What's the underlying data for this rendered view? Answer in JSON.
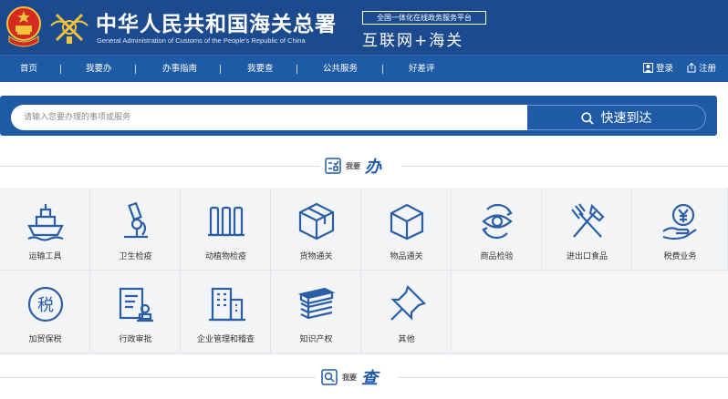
{
  "header": {
    "title": "中华人民共和国海关总署",
    "subtitle": "General Administration of Customs of the People's Republic of China",
    "platform_tag": "全国一体化在线政务服务平台",
    "platform_name": "互联网+海关"
  },
  "nav": {
    "items": [
      {
        "label": "首页"
      },
      {
        "label": "我要办"
      },
      {
        "label": "办事指南"
      },
      {
        "label": "我要查"
      },
      {
        "label": "公共服务"
      },
      {
        "label": "好差评"
      }
    ],
    "login": "登录",
    "register": "注册"
  },
  "search": {
    "placeholder": "请输入您要办理的事项或服务",
    "button": "快速到达"
  },
  "sections": {
    "handle": {
      "small": "我要",
      "big": "办"
    },
    "query": {
      "small": "我要",
      "big": "查"
    }
  },
  "services": [
    {
      "label": "运输工具",
      "icon": "ship-icon"
    },
    {
      "label": "卫生检疫",
      "icon": "microscope-icon"
    },
    {
      "label": "动植物检疫",
      "icon": "quarantine-icon"
    },
    {
      "label": "货物通关",
      "icon": "cargo-box-icon"
    },
    {
      "label": "物品通关",
      "icon": "parcel-icon"
    },
    {
      "label": "商品检验",
      "icon": "inspection-eye-icon"
    },
    {
      "label": "进出口食品",
      "icon": "fork-knife-icon"
    },
    {
      "label": "税费业务",
      "icon": "tax-fee-hand-icon"
    },
    {
      "label": "加贸保税",
      "icon": "tax-circle-icon"
    },
    {
      "label": "行政审批",
      "icon": "approval-stamp-icon"
    },
    {
      "label": "企业管理和稽查",
      "icon": "building-icon"
    },
    {
      "label": "知识产权",
      "icon": "books-stack-icon"
    },
    {
      "label": "其他",
      "icon": "pin-icon"
    }
  ],
  "colors": {
    "header_bg": "#1b4a8e",
    "nav_bg": "#1f5aa6",
    "accent": "#1f5aa6",
    "icon_stroke": "#2a5fa8",
    "emblem_red": "#d42a20",
    "emblem_gold": "#f3c33a"
  }
}
